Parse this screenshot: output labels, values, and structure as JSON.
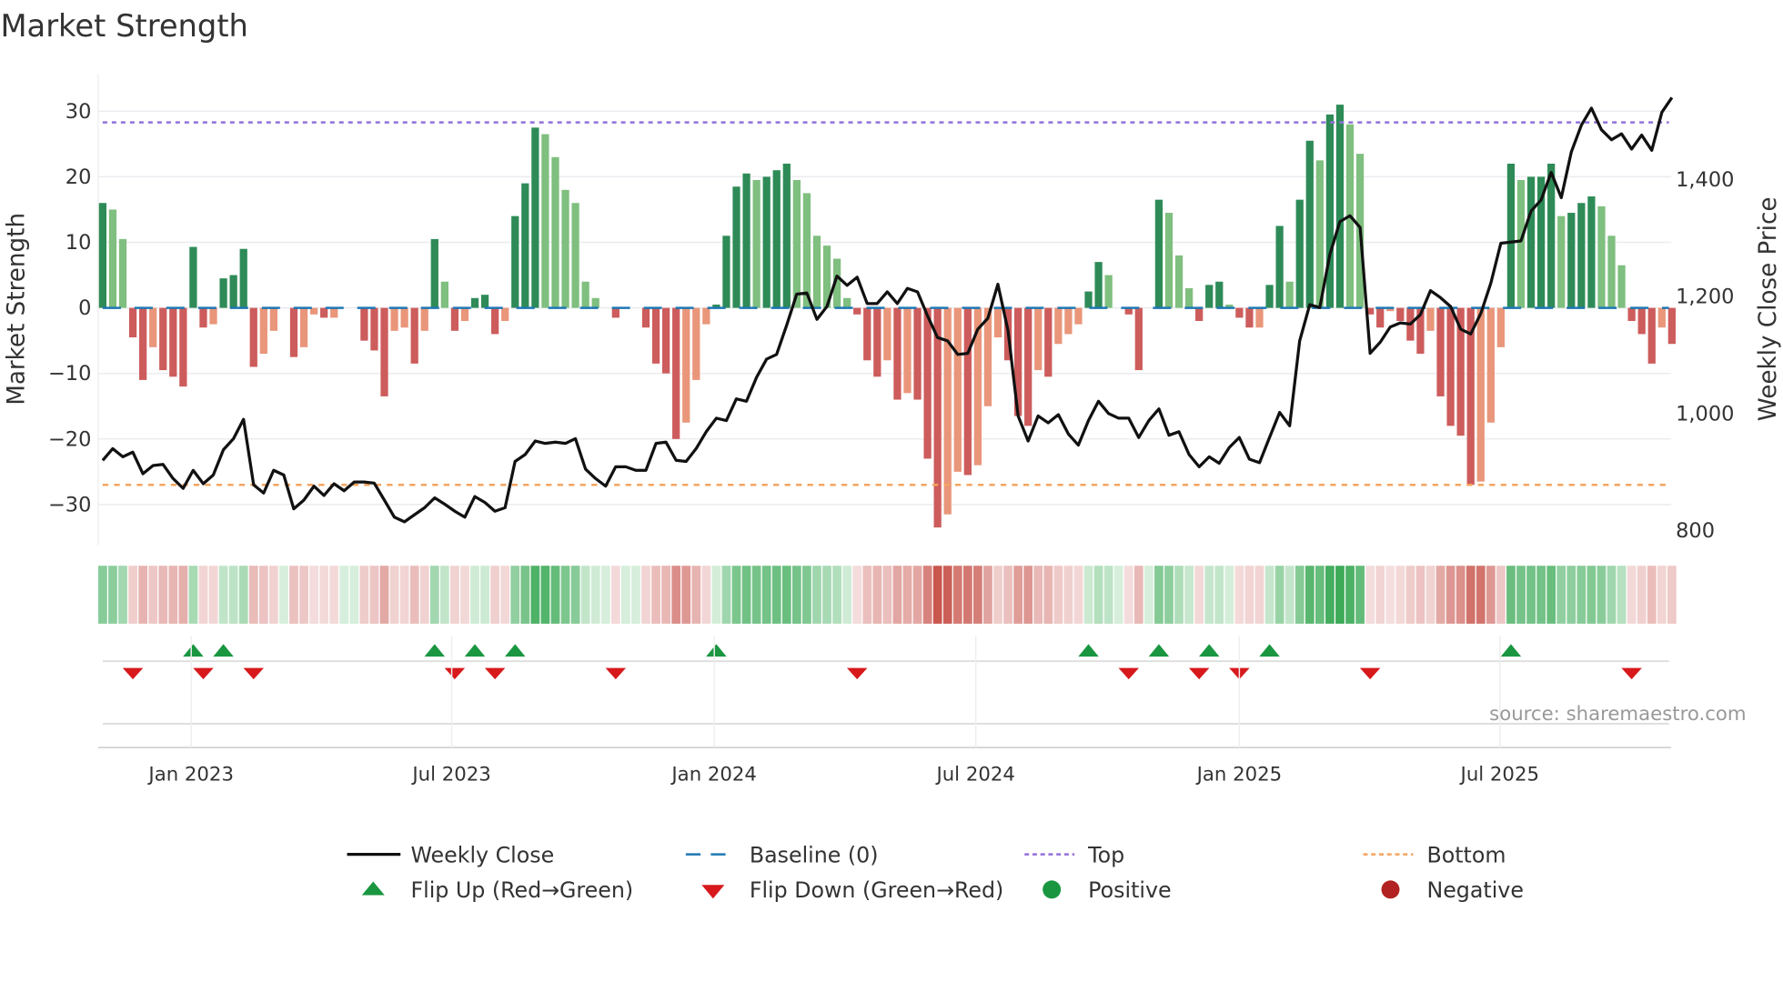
{
  "chart_data": {
    "type": "bar",
    "title": "Market Strength",
    "ylabel": "Market Strength",
    "y2label": "Weekly Close Price",
    "ylim": [
      -36,
      36
    ],
    "y2lim": [
      790,
      1600
    ],
    "yticks": [
      30,
      20,
      10,
      0,
      -10,
      -20,
      -30
    ],
    "yticklabels": [
      "30",
      "20",
      "10",
      "0",
      "−10",
      "−20",
      "−30"
    ],
    "y2ticks": [
      1400,
      1200,
      1000,
      800
    ],
    "y2ticklabels": [
      "1,400",
      "1,200",
      "1,000",
      "800"
    ],
    "xticks": [
      {
        "week": 8.8,
        "label": "Jan 2023"
      },
      {
        "week": 34.7,
        "label": "Jul 2023"
      },
      {
        "week": 60.8,
        "label": "Jan 2024"
      },
      {
        "week": 86.8,
        "label": "Jul 2024"
      },
      {
        "week": 113,
        "label": "Jan 2025"
      },
      {
        "week": 138.9,
        "label": "Jul 2025"
      }
    ],
    "top_level": 28.3,
    "bottom_level": -27,
    "strength": [
      16,
      15,
      10.5,
      -4.5,
      -11,
      -6,
      -9.5,
      -10.5,
      -12,
      9.3,
      -3,
      -2.5,
      4.5,
      5,
      9,
      -9,
      -7,
      -3.5,
      0,
      -7.5,
      -6,
      -1,
      -1.5,
      -1.5,
      0,
      0,
      -5,
      -6.5,
      -13.5,
      -3.5,
      -3,
      -8.5,
      -3.5,
      10.5,
      4,
      -3.5,
      -2,
      1.5,
      2,
      -4,
      -2,
      14,
      19,
      27.5,
      26.5,
      23,
      18,
      16,
      4,
      1.5,
      0,
      -1.5,
      0,
      0,
      -3,
      -8.5,
      -10,
      -20,
      -17.5,
      -11,
      -2.5,
      0.5,
      11,
      18.5,
      20.5,
      19.5,
      20,
      21,
      22,
      19.5,
      17.5,
      11,
      9.5,
      7.5,
      1.5,
      -1,
      -8,
      -10.5,
      -8,
      -14,
      -13,
      -14,
      -23,
      -33.5,
      -31.5,
      -25,
      -25.5,
      -24,
      -15,
      -4.5,
      -8,
      -16.5,
      -18,
      -9.5,
      -10.5,
      -5.5,
      -4,
      -2.5,
      2.5,
      7,
      5,
      0,
      -1,
      -9.5,
      0,
      16.5,
      14.5,
      8,
      3,
      -2,
      3.5,
      4,
      0.5,
      -1.5,
      -3,
      -3,
      3.5,
      12.5,
      4,
      16.5,
      25.5,
      22.5,
      29.5,
      31,
      28,
      23.5,
      -1,
      -3,
      -0.5,
      -2,
      -5,
      -7,
      -3.5,
      -13.5,
      -18,
      -19.5,
      -27,
      -26.5,
      -17.5,
      -6,
      22,
      19.5,
      20,
      20,
      22,
      14,
      14.5,
      16,
      17,
      15.5,
      11,
      6.5,
      -2,
      -4,
      -8.5,
      -3,
      -5.5
    ],
    "weekly_close": [
      920,
      940,
      926,
      934,
      897,
      911,
      913,
      889,
      872,
      903,
      880,
      895,
      938,
      957,
      990,
      878,
      864,
      903,
      895,
      837,
      852,
      876,
      860,
      880,
      868,
      883,
      883,
      881,
      852,
      823,
      815,
      827,
      839,
      856,
      845,
      833,
      823,
      858,
      848,
      833,
      839,
      918,
      930,
      953,
      949,
      951,
      949,
      957,
      905,
      889,
      876,
      909,
      909,
      903,
      903,
      949,
      951,
      920,
      918,
      940,
      969,
      992,
      988,
      1025,
      1021,
      1062,
      1093,
      1101,
      1151,
      1204,
      1206,
      1161,
      1183,
      1235,
      1219,
      1233,
      1188,
      1188,
      1208,
      1188,
      1214,
      1208,
      1167,
      1130,
      1124,
      1101,
      1103,
      1144,
      1163,
      1221,
      1142,
      996,
      953,
      996,
      984,
      998,
      965,
      946,
      988,
      1021,
      1000,
      992,
      992,
      959,
      988,
      1008,
      963,
      969,
      930,
      909,
      926,
      915,
      942,
      959,
      922,
      916,
      959,
      1002,
      979,
      1124,
      1186,
      1181,
      1272,
      1328,
      1338,
      1318,
      1103,
      1122,
      1148,
      1155,
      1153,
      1169,
      1210,
      1198,
      1183,
      1144,
      1136,
      1171,
      1223,
      1291,
      1293,
      1295,
      1346,
      1365,
      1412,
      1369,
      1447,
      1493,
      1522,
      1485,
      1468,
      1478,
      1452,
      1476,
      1450,
      1515,
      1540
    ],
    "flip_up_weeks": [
      9,
      12,
      33,
      37,
      41,
      61,
      98,
      105,
      110,
      116,
      140
    ],
    "flip_down_weeks": [
      3,
      10,
      15,
      35,
      39,
      51,
      75,
      102,
      109,
      113,
      126,
      152
    ],
    "legend": {
      "placement": "bottom",
      "weekly_close": "Weekly Close",
      "baseline": "Baseline (0)",
      "top": "Top",
      "bottom": "Bottom",
      "flip_up": "Flip Up (Red→Green)",
      "flip_down": "Flip Down (Green→Red)",
      "positive": "Positive",
      "negative": "Negative"
    },
    "source": "source: sharemaestro.com"
  },
  "colors": {
    "pos_rising": "#2e8b57",
    "pos_falling": "#7fbf7f",
    "neg_falling": "#cd5c5c",
    "neg_rising": "#e9967a",
    "baseline": "#1f77b4",
    "top": "#9370db",
    "bottom": "#f4a460",
    "line": "#111111",
    "flip_up": "#1a9641",
    "flip_down": "#d7191c",
    "positive_dot": "#1a9641",
    "negative_dot": "#b22222"
  }
}
